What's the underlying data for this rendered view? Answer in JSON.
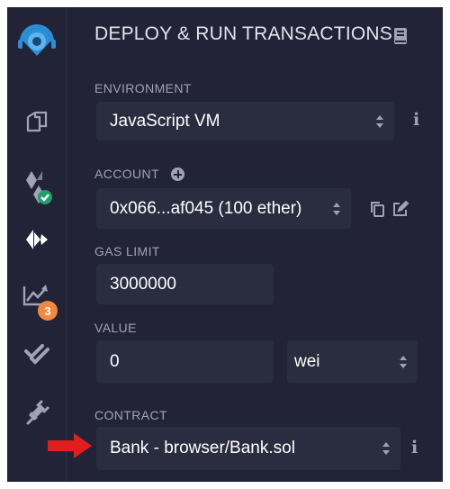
{
  "panel": {
    "title": "DEPLOY & RUN TRANSACTIONS",
    "environment": {
      "label": "ENVIRONMENT",
      "value": "JavaScript VM"
    },
    "account": {
      "label": "ACCOUNT",
      "value": "0x066...af045 (100 ether)"
    },
    "gas_limit": {
      "label": "GAS LIMIT",
      "value": "3000000"
    },
    "value": {
      "label": "VALUE",
      "amount": "0",
      "unit": "wei"
    },
    "contract": {
      "label": "CONTRACT",
      "value": "Bank - browser/Bank.sol"
    }
  },
  "iconbar": {
    "items": [
      "remix-logo-icon",
      "file-explorer-icon",
      "solidity-compiler-icon",
      "deploy-run-icon",
      "analysis-icon",
      "testing-icon",
      "plugin-manager-icon"
    ],
    "analysis_badge": "3"
  },
  "colors": {
    "background": "#222336",
    "field": "#2a2c3f",
    "label": "#a1a3b5",
    "accent_blue": "#2b8fd6",
    "success_green": "#1fa06b",
    "warning_orange": "#f0883e",
    "arrow_red": "#e11e1e"
  }
}
